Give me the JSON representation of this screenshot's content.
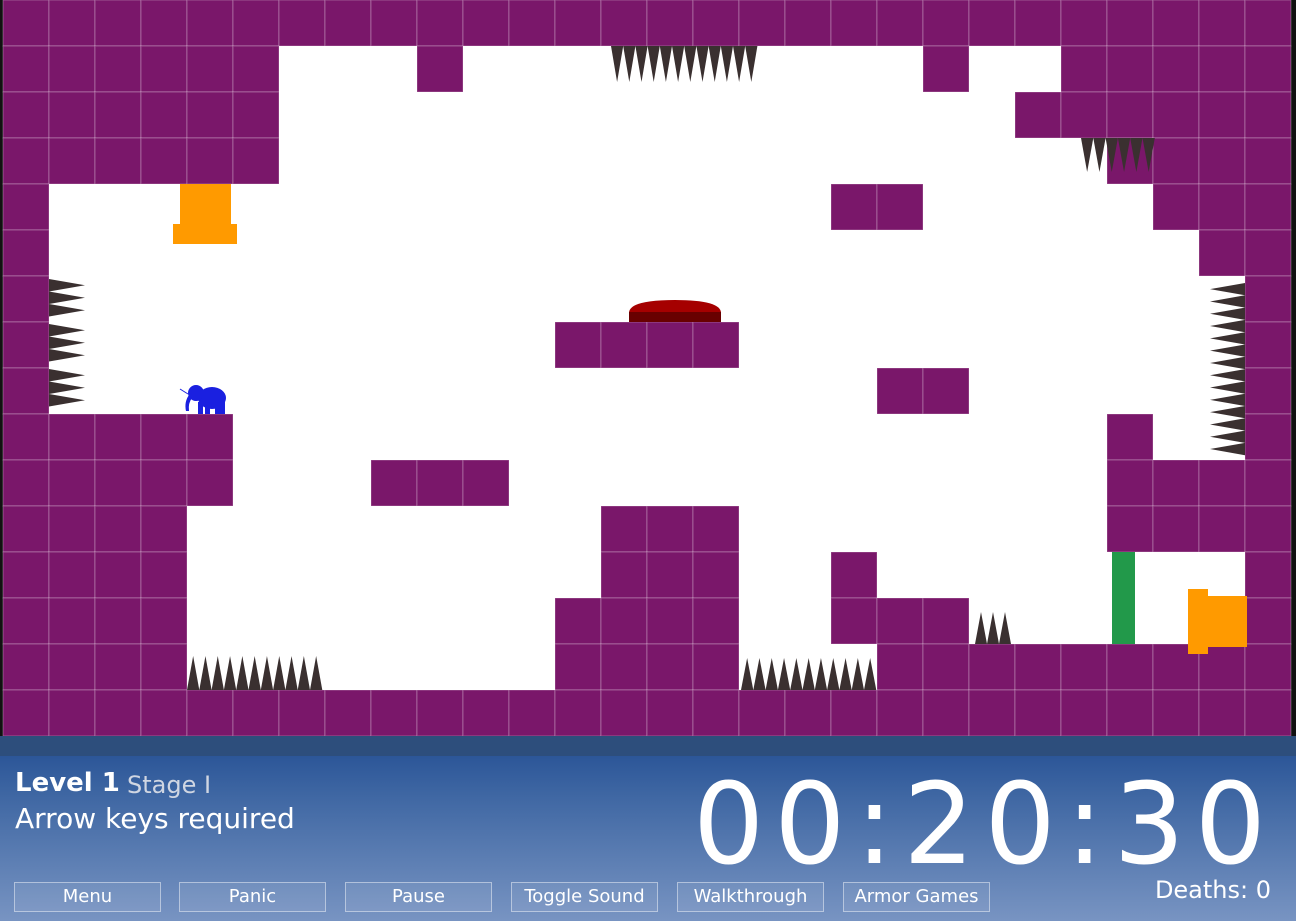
{
  "hud": {
    "level": "Level 1",
    "stage": "Stage I",
    "hint": "Arrow keys required",
    "timer": "00:20:30",
    "deaths": "Deaths: 0"
  },
  "buttons": [
    "Menu",
    "Panic",
    "Pause",
    "Toggle Sound",
    "Walkthrough",
    "Armor Games"
  ],
  "colors": {
    "wall": "#7a176a",
    "spike": "#3a3030",
    "player": "#1a20e0",
    "exit": "#ff9a00",
    "door": "#22994a",
    "button": "#a50000"
  }
}
